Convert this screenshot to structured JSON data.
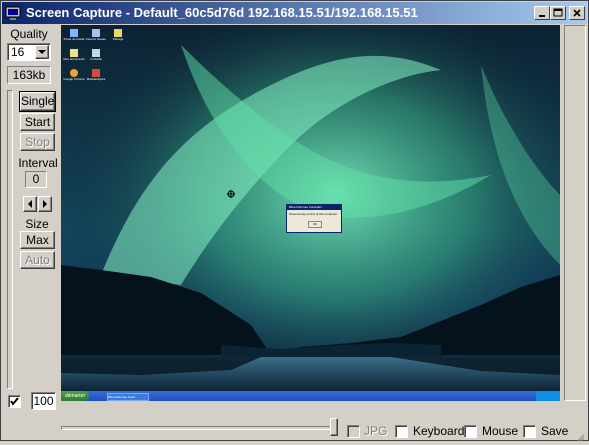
{
  "window": {
    "title": "Screen Capture - Default_60c5d76d 192.168.15.51/192.168.15.51"
  },
  "titlebar_buttons": {
    "minimize": "minimize-icon",
    "maximize": "maximize-icon",
    "close": "close-icon"
  },
  "controls": {
    "quality_label": "Quality",
    "quality_value": "16",
    "size_readout": "163kb",
    "single_label": "Single",
    "start_label": "Start",
    "stop_label": "Stop",
    "interval_label": "Interval",
    "interval_value": "0",
    "size_label": "Size",
    "max_label": "Max",
    "auto_label": "Auto",
    "scale_value": "100"
  },
  "options": {
    "jpg_label": "JPG",
    "keyboard_label": "Keyboard",
    "mouse_label": "Mouse",
    "save_label": "Save"
  },
  "remote_desktop": {
    "icons": [
      {
        "caption": "Poste de travail",
        "icon": "computer-icon"
      },
      {
        "caption": "Favoris réseau",
        "icon": "network-icon"
      },
      {
        "caption": "Partagé",
        "icon": "folder-icon"
      },
      {
        "caption": "Mes documents",
        "icon": "documents-icon"
      },
      {
        "caption": "Corbeille",
        "icon": "recycle-bin-icon"
      },
      {
        "caption": "Google Chrome",
        "icon": "chrome-icon"
      },
      {
        "caption": "Malwarebytes",
        "icon": "malwarebytes-icon"
      }
    ],
    "dialog_title": "Bitnet Remote Controller",
    "dialog_message": "Overcoming control of this computer",
    "dialog_button": "Ok",
    "start_label": "démarrer",
    "task_label": "Bitnet Remote Contr"
  },
  "colors": {
    "window_bg": "#d4d0c8",
    "title_start": "#0a246a",
    "title_end": "#a6caf0",
    "aurora": "#5fe0a8",
    "taskbar": "#245edb"
  }
}
